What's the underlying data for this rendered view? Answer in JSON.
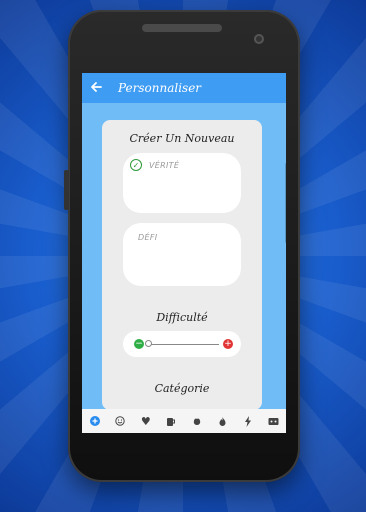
{
  "header": {
    "title": "Personnaliser",
    "back_icon": "arrow-left-icon"
  },
  "card": {
    "heading": "Créer Un Nouveau",
    "truth_placeholder": "VÉRITÉ",
    "dare_placeholder": "DÉFI",
    "difficulty_label": "Difficulté",
    "difficulty_level": 0,
    "category_label": "Catégorie"
  },
  "navbar": {
    "items": [
      "plus-icon",
      "smile-icon",
      "heart-icon",
      "beer-icon",
      "peach-icon",
      "flame-icon",
      "lightning-icon",
      "mask-icon"
    ],
    "active": "plus-icon"
  },
  "colors": {
    "appbar": "#3e9cf3",
    "screen_bg": "#6fbcf6",
    "accent_green": "#2fae45",
    "accent_red": "#e23434"
  }
}
